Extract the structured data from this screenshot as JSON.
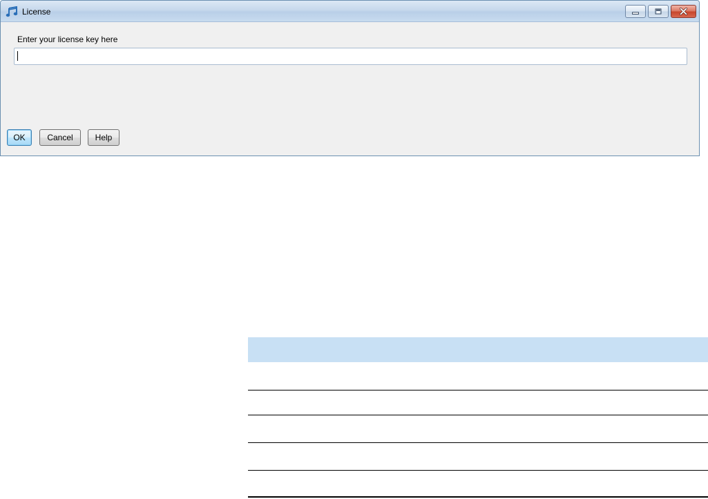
{
  "window": {
    "title": "License",
    "app_icon": "music-note-icon",
    "caption_buttons": [
      "minimize-icon",
      "restore-icon",
      "close-icon"
    ]
  },
  "form": {
    "prompt_label": "Enter your license key here",
    "license_input_value": "",
    "license_input_placeholder": ""
  },
  "buttons": {
    "ok_label": "OK",
    "cancel_label": "Cancel",
    "help_label": "Help"
  },
  "colors": {
    "titlebar": "#c6d8ec",
    "dialog_background": "#f0f0f0",
    "default_button_accent": "#3c7fb1",
    "close_button": "#c7452c",
    "table_header": "#c8e0f4"
  }
}
